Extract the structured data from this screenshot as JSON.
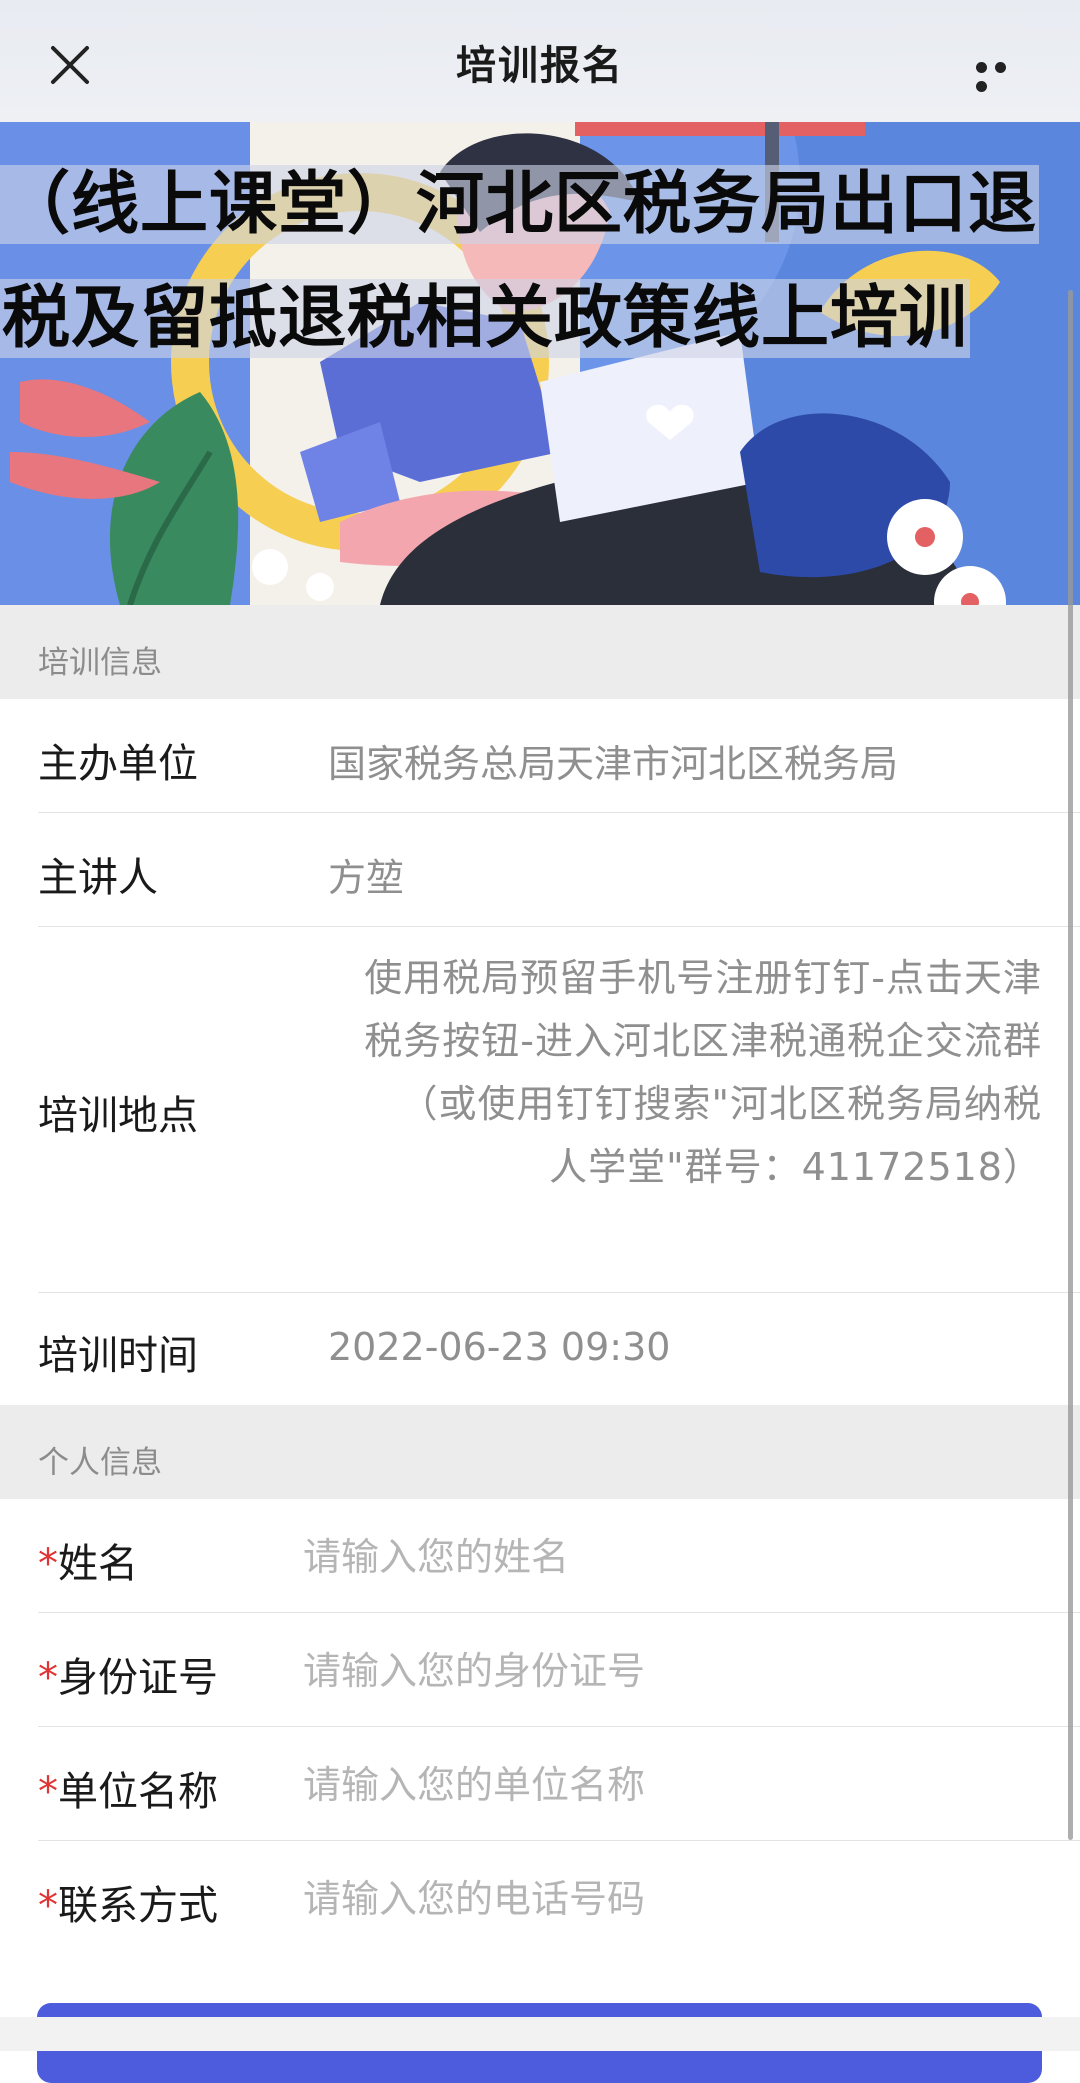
{
  "navbar": {
    "title": "培训报名",
    "close_icon": "close-icon",
    "more_icon": "more-dots-icon"
  },
  "banner": {
    "title": "（线上课堂）河北区税务局出口退税及留抵退税相关政策线上培训"
  },
  "training_info": {
    "section_title": "培训信息",
    "organizer_label": "主办单位",
    "organizer_value": "国家税务总局天津市河北区税务局",
    "speaker_label": "主讲人",
    "speaker_value": "方堃",
    "location_label": "培训地点",
    "location_value": "使用税局预留手机号注册钉钉-点击天津税务按钮-进入河北区津税通税企交流群（或使用钉钉搜索\"河北区税务局纳税人学堂\"群号：41172518）",
    "time_label": "培训时间",
    "time_value": "2022-06-23 09:30"
  },
  "personal_info": {
    "section_title": "个人信息",
    "required_mark": "*",
    "name_label": "姓名",
    "name_placeholder": "请输入您的姓名",
    "id_label": "身份证号",
    "id_placeholder": "请输入您的身份证号",
    "company_label": "单位名称",
    "company_placeholder": "请输入您的单位名称",
    "contact_label": "联系方式",
    "contact_placeholder": "请输入您的电话号码"
  },
  "colors": {
    "accent": "#4d5cdc",
    "required": "#e03434",
    "banner_bg": "#5b86dd"
  }
}
